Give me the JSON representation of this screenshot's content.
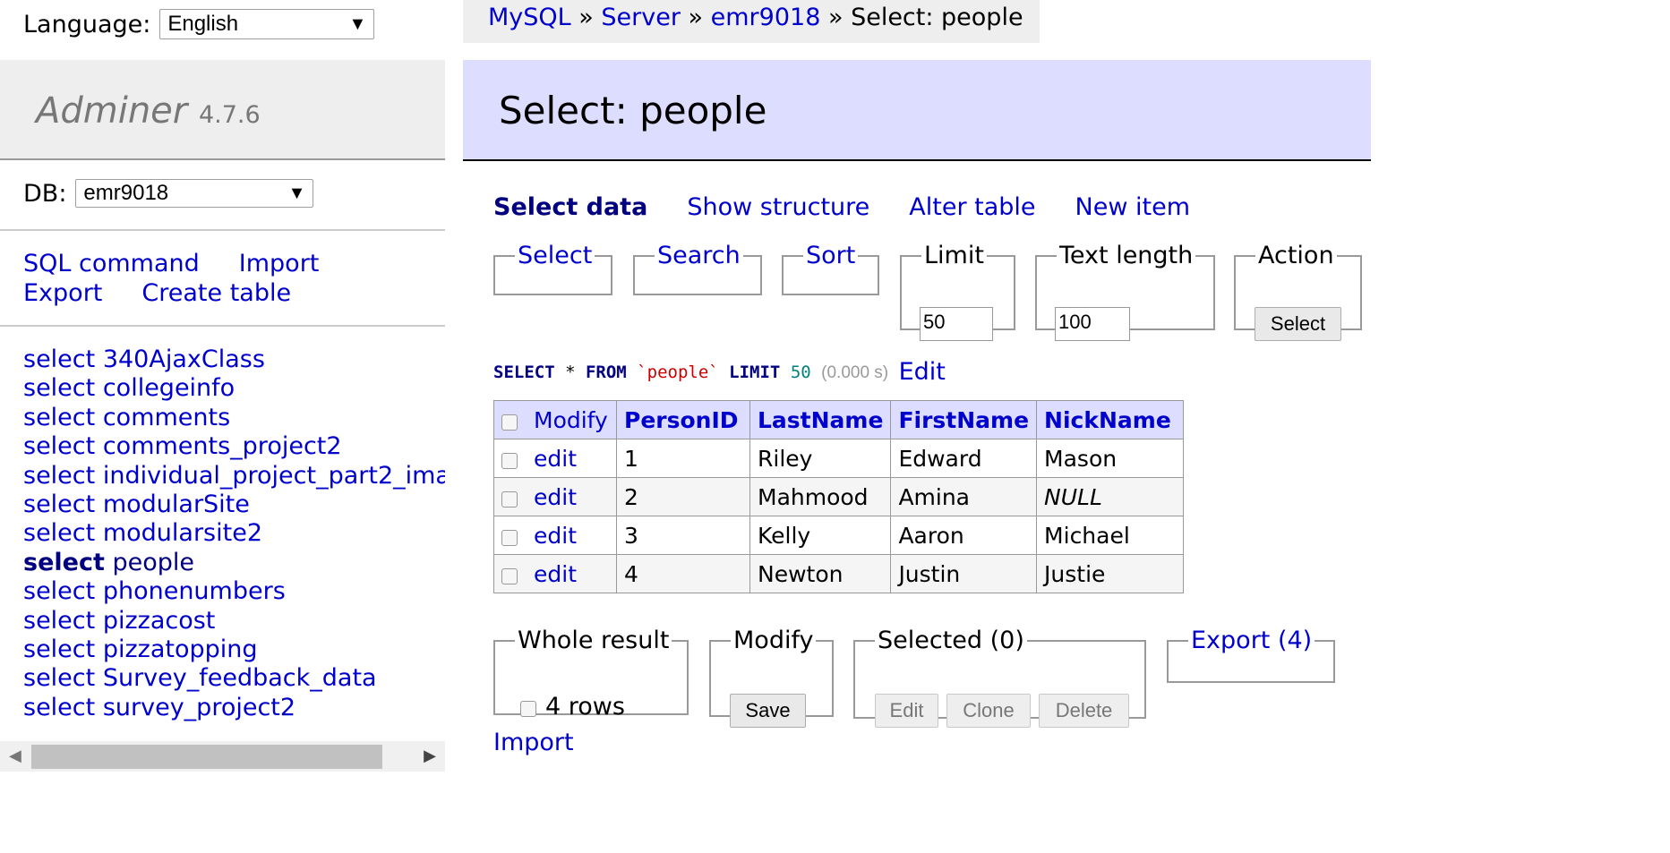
{
  "language": {
    "label": "Language:",
    "selected": "English"
  },
  "app": {
    "name": "Adminer",
    "version": "4.7.6"
  },
  "db": {
    "label": "DB:",
    "selected": "emr9018"
  },
  "sidebar_links": [
    {
      "label": "SQL command"
    },
    {
      "label": "Import"
    },
    {
      "label": "Export"
    },
    {
      "label": "Create table"
    }
  ],
  "tables": [
    {
      "kw": "select",
      "name": "340AjaxClass"
    },
    {
      "kw": "select",
      "name": "collegeinfo"
    },
    {
      "kw": "select",
      "name": "comments"
    },
    {
      "kw": "select",
      "name": "comments_project2"
    },
    {
      "kw": "select",
      "name": "individual_project_part2_ima"
    },
    {
      "kw": "select",
      "name": "modularSite"
    },
    {
      "kw": "select",
      "name": "modularsite2"
    },
    {
      "kw": "select",
      "name": "people",
      "active": true
    },
    {
      "kw": "select",
      "name": "phonenumbers"
    },
    {
      "kw": "select",
      "name": "pizzacost"
    },
    {
      "kw": "select",
      "name": "pizzatopping"
    },
    {
      "kw": "select",
      "name": "Survey_feedback_data"
    },
    {
      "kw": "select",
      "name": "survey_project2"
    }
  ],
  "breadcrumb": {
    "items": [
      "MySQL",
      "Server",
      "emr9018"
    ],
    "separator": " » ",
    "current": "Select: people"
  },
  "page_title": "Select: people",
  "menu": {
    "select_data": "Select data",
    "show_structure": "Show structure",
    "alter_table": "Alter table",
    "new_item": "New item"
  },
  "controls": {
    "select": "Select",
    "search": "Search",
    "sort": "Sort",
    "limit": {
      "legend": "Limit",
      "value": "50"
    },
    "text_length": {
      "legend": "Text length",
      "value": "100"
    },
    "action": {
      "legend": "Action",
      "button": "Select"
    }
  },
  "sql": {
    "kw1": "SELECT",
    "star": " * ",
    "kw2": "FROM",
    "table": "`people`",
    "kw3": "LIMIT",
    "limit": "50",
    "time": "(0.000 s)",
    "edit": "Edit"
  },
  "grid": {
    "modify": "Modify",
    "edit_label": "edit",
    "columns": [
      "PersonID",
      "LastName",
      "FirstName",
      "NickName"
    ],
    "rows": [
      [
        "1",
        "Riley",
        "Edward",
        "Mason"
      ],
      [
        "2",
        "Mahmood",
        "Amina",
        "NULL"
      ],
      [
        "3",
        "Kelly",
        "Aaron",
        "Michael"
      ],
      [
        "4",
        "Newton",
        "Justin",
        "Justie"
      ]
    ]
  },
  "bottom": {
    "whole_result": {
      "legend": "Whole result",
      "rows": "4 rows"
    },
    "modify": {
      "legend": "Modify",
      "save": "Save"
    },
    "selected": {
      "legend": "Selected (0)",
      "edit": "Edit",
      "clone": "Clone",
      "delete": "Delete"
    },
    "export": "Export (4)",
    "import": "Import"
  },
  "colors": {
    "accent_bg": "#ddddff",
    "link": "#0000cc",
    "active": "#000080"
  }
}
